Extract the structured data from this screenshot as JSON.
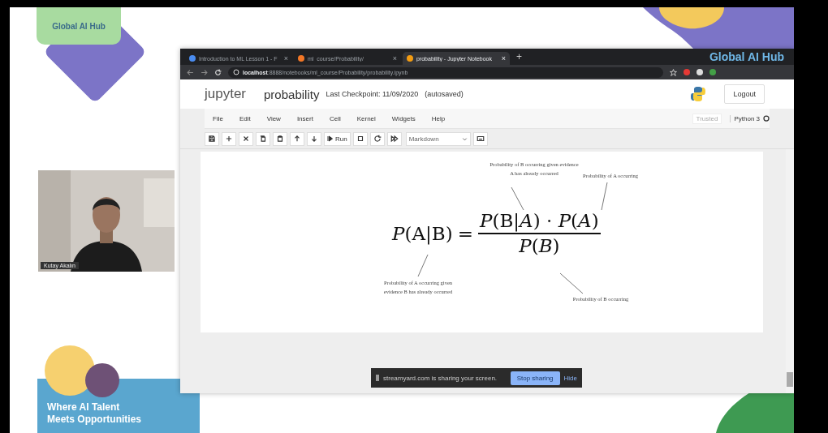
{
  "branding": {
    "logo": "Global AI Hub",
    "tagline": "Where AI Talent Meets Opportunities"
  },
  "webcam": {
    "name": "Kutay Akalın"
  },
  "browser": {
    "tabs": [
      {
        "title": "Introduction to ML Lesson 1 - F",
        "close": "×",
        "selected": false
      },
      {
        "title": "ml_course/Probability/",
        "close": "×",
        "selected": false
      },
      {
        "title": "probability - Jupyter Notebook",
        "close": "×",
        "selected": true
      }
    ],
    "new_tab": "+",
    "brand": "Global AI Hub",
    "url_host": "localhost",
    "url_path": ":8888/notebooks/ml_course/Probability/probability.ipynb"
  },
  "jupyter": {
    "logo": "jupyter",
    "notebook": "probability",
    "checkpoint": "Last Checkpoint: 11/09/2020",
    "autosaved": "(autosaved)",
    "logout": "Logout",
    "menu": [
      "File",
      "Edit",
      "View",
      "Insert",
      "Cell",
      "Kernel",
      "Widgets",
      "Help"
    ],
    "trusted": "Trusted",
    "kernel": "Python 3",
    "run": "Run",
    "cell_type": "Markdown"
  },
  "cell": {
    "formula": {
      "lhs": "*P*(A|B)",
      "equals": "=",
      "numerator": "*P*(B|*A*) · *P*(*A*)",
      "denominator": "*P*(*B*)"
    },
    "annotations": [
      {
        "text": "Probability of B occurring given evidence A has already occurred"
      },
      {
        "text": "Probability of A occurring"
      },
      {
        "text": "Probability of A occurring given evidence B has already occurred"
      },
      {
        "text": "Probability of B occurring"
      }
    ]
  },
  "share_bar": {
    "message": "streamyard.com is sharing your screen.",
    "stop": "Stop sharing",
    "hide": "Hide"
  }
}
